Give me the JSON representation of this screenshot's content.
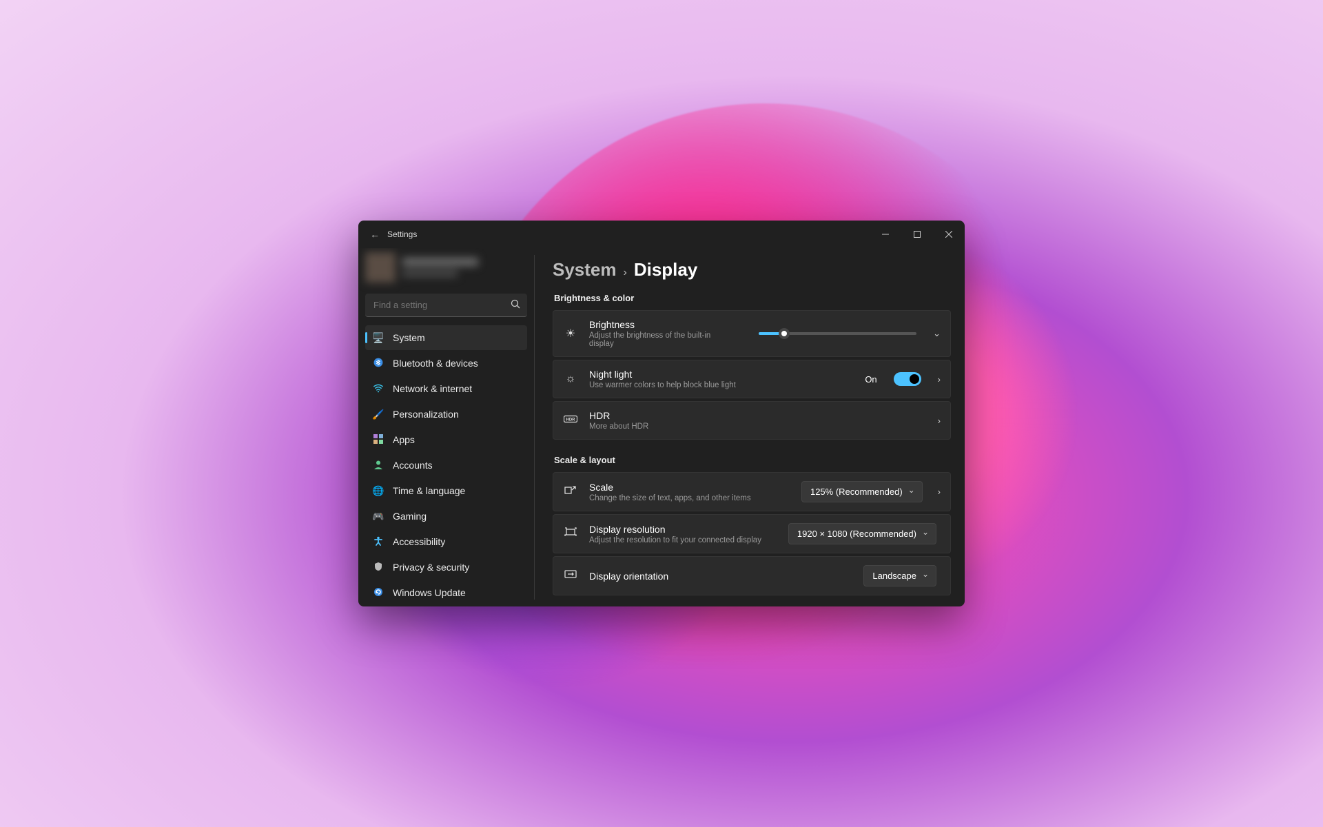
{
  "titlebar": {
    "title": "Settings"
  },
  "search": {
    "placeholder": "Find a setting"
  },
  "sidebar": {
    "items": [
      {
        "label": "System"
      },
      {
        "label": "Bluetooth & devices"
      },
      {
        "label": "Network & internet"
      },
      {
        "label": "Personalization"
      },
      {
        "label": "Apps"
      },
      {
        "label": "Accounts"
      },
      {
        "label": "Time & language"
      },
      {
        "label": "Gaming"
      },
      {
        "label": "Accessibility"
      },
      {
        "label": "Privacy & security"
      },
      {
        "label": "Windows Update"
      }
    ]
  },
  "breadcrumb": {
    "parent": "System",
    "current": "Display"
  },
  "sections": {
    "brightness_color": {
      "label": "Brightness & color",
      "brightness": {
        "title": "Brightness",
        "sub": "Adjust the brightness of the built-in display",
        "value_pct": 16
      },
      "night_light": {
        "title": "Night light",
        "sub": "Use warmer colors to help block blue light",
        "state": "On"
      },
      "hdr": {
        "title": "HDR",
        "sub": "More about HDR"
      }
    },
    "scale_layout": {
      "label": "Scale & layout",
      "scale": {
        "title": "Scale",
        "sub": "Change the size of text, apps, and other items",
        "value": "125% (Recommended)"
      },
      "resolution": {
        "title": "Display resolution",
        "sub": "Adjust the resolution to fit your connected display",
        "value": "1920 × 1080 (Recommended)"
      },
      "orientation": {
        "title": "Display orientation",
        "value": "Landscape"
      }
    }
  }
}
